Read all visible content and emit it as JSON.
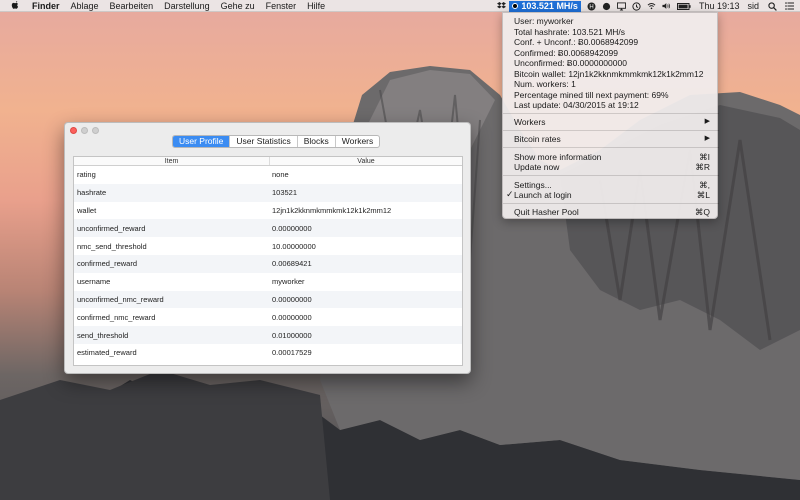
{
  "menubar": {
    "app_name": "Finder",
    "menus": [
      "Ablage",
      "Bearbeiten",
      "Darstellung",
      "Gehe zu",
      "Fenster",
      "Hilfe"
    ],
    "hashrate": "103.521 MH/s",
    "clock": "Thu 19:13",
    "user": "sid"
  },
  "dropdown": {
    "info": [
      "User: myworker",
      "Total hashrate: 103.521 MH/s",
      "Conf. + Unconf.: Ƀ0.0068942099",
      "Confirmed: Ƀ0.0068942099",
      "Unconfirmed: Ƀ0.0000000000",
      "Bitcoin wallet: 12jn1k2kknmkmmkmk12k1k2mm12",
      "Num. workers: 1",
      "Percentage mined till next payment: 69%",
      "Last update: 04/30/2015 at 19:12"
    ],
    "workers_label": "Workers",
    "bitcoin_rates_label": "Bitcoin rates",
    "show_more_label": "Show more information",
    "show_more_shortcut": "⌘I",
    "update_label": "Update now",
    "update_shortcut": "⌘R",
    "settings_label": "Settings...",
    "settings_shortcut": "⌘,",
    "launch_label": "Launch at login",
    "launch_shortcut": "⌘L",
    "quit_label": "Quit Hasher Pool",
    "quit_shortcut": "⌘Q"
  },
  "window": {
    "tabs": [
      "User Profile",
      "User Statistics",
      "Blocks",
      "Workers"
    ],
    "active_tab": "User Profile",
    "columns": {
      "item": "Item",
      "value": "Value"
    },
    "rows": [
      {
        "item": "rating",
        "value": "none"
      },
      {
        "item": "hashrate",
        "value": "103521"
      },
      {
        "item": "wallet",
        "value": "12jn1k2kknmkmmkmk12k1k2mm12"
      },
      {
        "item": "unconfirmed_reward",
        "value": "0.00000000"
      },
      {
        "item": "nmc_send_threshold",
        "value": "10.00000000"
      },
      {
        "item": "confirmed_reward",
        "value": "0.00689421"
      },
      {
        "item": "username",
        "value": "myworker"
      },
      {
        "item": "unconfirmed_nmc_reward",
        "value": "0.00000000"
      },
      {
        "item": "confirmed_nmc_reward",
        "value": "0.00000000"
      },
      {
        "item": "send_threshold",
        "value": "0.01000000"
      },
      {
        "item": "estimated_reward",
        "value": "0.00017529"
      }
    ]
  },
  "colors": {
    "accent": "#3b8cf2",
    "hashrate_highlight": "#1f6fd6",
    "close_button": "#fc605c"
  }
}
